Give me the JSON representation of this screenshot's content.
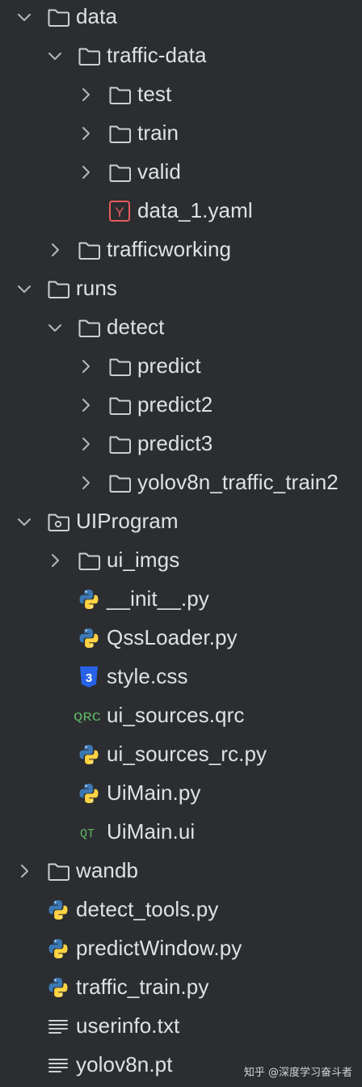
{
  "project_tree": {
    "items": [
      {
        "label": "data",
        "depth": 0,
        "type": "folder",
        "state": "expanded"
      },
      {
        "label": "traffic-data",
        "depth": 1,
        "type": "folder",
        "state": "expanded"
      },
      {
        "label": "test",
        "depth": 2,
        "type": "folder",
        "state": "collapsed"
      },
      {
        "label": "train",
        "depth": 2,
        "type": "folder",
        "state": "collapsed"
      },
      {
        "label": "valid",
        "depth": 2,
        "type": "folder",
        "state": "collapsed"
      },
      {
        "label": "data_1.yaml",
        "depth": 2,
        "type": "yaml",
        "state": "leaf"
      },
      {
        "label": "trafficworking",
        "depth": 1,
        "type": "folder",
        "state": "collapsed"
      },
      {
        "label": "runs",
        "depth": 0,
        "type": "folder",
        "state": "expanded"
      },
      {
        "label": "detect",
        "depth": 1,
        "type": "folder",
        "state": "expanded"
      },
      {
        "label": "predict",
        "depth": 2,
        "type": "folder",
        "state": "collapsed"
      },
      {
        "label": "predict2",
        "depth": 2,
        "type": "folder",
        "state": "collapsed"
      },
      {
        "label": "predict3",
        "depth": 2,
        "type": "folder",
        "state": "collapsed"
      },
      {
        "label": "yolov8n_traffic_train2",
        "depth": 2,
        "type": "folder",
        "state": "collapsed"
      },
      {
        "label": "UIProgram",
        "depth": 0,
        "type": "package",
        "state": "expanded"
      },
      {
        "label": "ui_imgs",
        "depth": 1,
        "type": "folder",
        "state": "collapsed"
      },
      {
        "label": "__init__.py",
        "depth": 1,
        "type": "python",
        "state": "leaf"
      },
      {
        "label": "QssLoader.py",
        "depth": 1,
        "type": "python",
        "state": "leaf"
      },
      {
        "label": "style.css",
        "depth": 1,
        "type": "css",
        "state": "leaf"
      },
      {
        "label": "ui_sources.qrc",
        "depth": 1,
        "type": "qrc",
        "state": "leaf"
      },
      {
        "label": "ui_sources_rc.py",
        "depth": 1,
        "type": "python",
        "state": "leaf"
      },
      {
        "label": "UiMain.py",
        "depth": 1,
        "type": "python",
        "state": "leaf"
      },
      {
        "label": "UiMain.ui",
        "depth": 1,
        "type": "qt",
        "state": "leaf"
      },
      {
        "label": "wandb",
        "depth": 0,
        "type": "folder",
        "state": "collapsed"
      },
      {
        "label": "detect_tools.py",
        "depth": 0,
        "type": "python",
        "state": "leaf"
      },
      {
        "label": "predictWindow.py",
        "depth": 0,
        "type": "python",
        "state": "leaf"
      },
      {
        "label": "traffic_train.py",
        "depth": 0,
        "type": "python",
        "state": "leaf"
      },
      {
        "label": "userinfo.txt",
        "depth": 0,
        "type": "text",
        "state": "leaf"
      },
      {
        "label": "yolov8n.pt",
        "depth": 0,
        "type": "text",
        "state": "leaf"
      }
    ]
  },
  "icon_text": {
    "yaml": "Y",
    "css": "3",
    "qrc": "QRC",
    "qt": "QT"
  },
  "watermark": "知乎 @深度学习奋斗者",
  "colors": {
    "background": "#2b2d30",
    "text": "#dfe1e5",
    "chevron": "#b4b8bf",
    "folder_stroke": "#ced0d6",
    "yaml_red": "#e55b5b",
    "css_blue": "#2862e9",
    "qt_green": "#5fb865",
    "python_blue": "#3c78b4",
    "python_yellow": "#ffd343"
  }
}
